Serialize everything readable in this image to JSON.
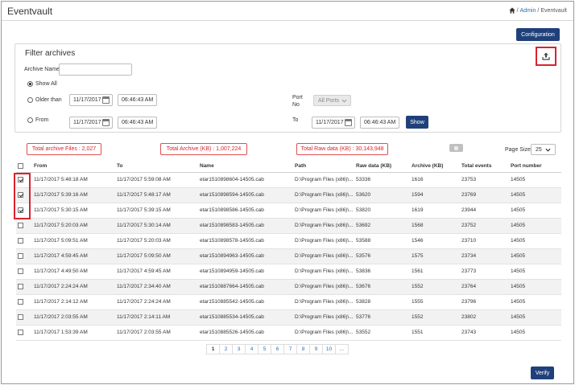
{
  "app": {
    "title": "Eventvault"
  },
  "breadcrumb": {
    "admin": "Admin",
    "sep1": "/",
    "sep2": "/",
    "current": "Eventvault"
  },
  "buttons": {
    "configuration": "Configuration",
    "show": "Show",
    "verify": "Verify"
  },
  "filter": {
    "title": "Filter archives",
    "archive_name_label": "Archive Name",
    "archive_name_value": "",
    "show_all_label": "Show All",
    "older_than_label": "Older than",
    "older_date": "11/17/2017",
    "older_time": "06:46:43 AM",
    "from_label": "From",
    "from_date": "11/17/2017",
    "from_time": "06:46:43 AM",
    "to_label": "To",
    "to_date": "11/17/2017",
    "to_time": "06:46:43 AM",
    "port_no_label_1": "Port",
    "port_no_label_2": "No",
    "ports_value": "All Ports",
    "selected_mode": "show_all"
  },
  "stats": {
    "total_files": "Total archive Files : 2,027",
    "total_archive": "Total Archive (KB) : 1,007,224",
    "total_raw": "Total Raw data (KB) : 30,143,948"
  },
  "page_size": {
    "label": "Page Size",
    "value": "25"
  },
  "table": {
    "columns": [
      "",
      "From",
      "To",
      "Name",
      "Path",
      "Raw data (KB)",
      "Archive (KB)",
      "Total events",
      "Port number"
    ],
    "rows": [
      {
        "checked": true,
        "from": "11/17/2017 5:48:18 AM",
        "to": "11/17/2017 5:59:08 AM",
        "name": "etar1510898604-14505.cab",
        "path": "D:\\Program Files (x86)\\...",
        "raw": "53336",
        "archive": "1616",
        "events": "23753",
        "port": "14505"
      },
      {
        "checked": true,
        "from": "11/17/2017 5:39:16 AM",
        "to": "11/17/2017 5:48:17 AM",
        "name": "etar1510898594-14505.cab",
        "path": "D:\\Program Files (x86)\\...",
        "raw": "53620",
        "archive": "1594",
        "events": "23769",
        "port": "14505"
      },
      {
        "checked": true,
        "from": "11/17/2017 5:30:15 AM",
        "to": "11/17/2017 5:39:15 AM",
        "name": "etar1510898586-14505.cab",
        "path": "D:\\Program Files (x86)\\...",
        "raw": "53820",
        "archive": "1619",
        "events": "23944",
        "port": "14505"
      },
      {
        "checked": false,
        "from": "11/17/2017 5:20:03 AM",
        "to": "11/17/2017 5:30:14 AM",
        "name": "etar1510898583-14505.cab",
        "path": "D:\\Program Files (x86)\\...",
        "raw": "53692",
        "archive": "1568",
        "events": "23752",
        "port": "14505"
      },
      {
        "checked": false,
        "from": "11/17/2017 5:09:51 AM",
        "to": "11/17/2017 5:20:03 AM",
        "name": "etar1510898578-14505.cab",
        "path": "D:\\Program Files (x86)\\...",
        "raw": "53588",
        "archive": "1546",
        "events": "23710",
        "port": "14505"
      },
      {
        "checked": false,
        "from": "11/17/2017 4:59:45 AM",
        "to": "11/17/2017 5:09:50 AM",
        "name": "etar1510894963-14505.cab",
        "path": "D:\\Program Files (x86)\\...",
        "raw": "53576",
        "archive": "1575",
        "events": "23734",
        "port": "14505"
      },
      {
        "checked": false,
        "from": "11/17/2017 4:49:50 AM",
        "to": "11/17/2017 4:59:45 AM",
        "name": "etar1510894959-14505.cab",
        "path": "D:\\Program Files (x86)\\...",
        "raw": "53836",
        "archive": "1561",
        "events": "23773",
        "port": "14505"
      },
      {
        "checked": false,
        "from": "11/17/2017 2:24:24 AM",
        "to": "11/17/2017 2:34:40 AM",
        "name": "etar1510887664-14505.cab",
        "path": "D:\\Program Files (x86)\\...",
        "raw": "53676",
        "archive": "1552",
        "events": "23764",
        "port": "14505"
      },
      {
        "checked": false,
        "from": "11/17/2017 2:14:12 AM",
        "to": "11/17/2017 2:24:24 AM",
        "name": "etar1510885542-14505.cab",
        "path": "D:\\Program Files (x86)\\...",
        "raw": "53828",
        "archive": "1555",
        "events": "23796",
        "port": "14505"
      },
      {
        "checked": false,
        "from": "11/17/2017 2:03:55 AM",
        "to": "11/17/2017 2:14:11 AM",
        "name": "etar1510885534-14505.cab",
        "path": "D:\\Program Files (x86)\\...",
        "raw": "53776",
        "archive": "1552",
        "events": "23802",
        "port": "14505"
      },
      {
        "checked": false,
        "from": "11/17/2017 1:53:39 AM",
        "to": "11/17/2017 2:03:55 AM",
        "name": "etar1510885526-14505.cab",
        "path": "D:\\Program Files (x86)\\...",
        "raw": "53552",
        "archive": "1551",
        "events": "23743",
        "port": "14505"
      }
    ]
  },
  "pagination": {
    "pages": [
      "1",
      "2",
      "3",
      "4",
      "5",
      "6",
      "7",
      "8",
      "9",
      "10",
      "..."
    ],
    "current": "1"
  },
  "colors": {
    "primary": "#20407a",
    "highlight": "#d9232d",
    "link": "#2a6fb0"
  }
}
